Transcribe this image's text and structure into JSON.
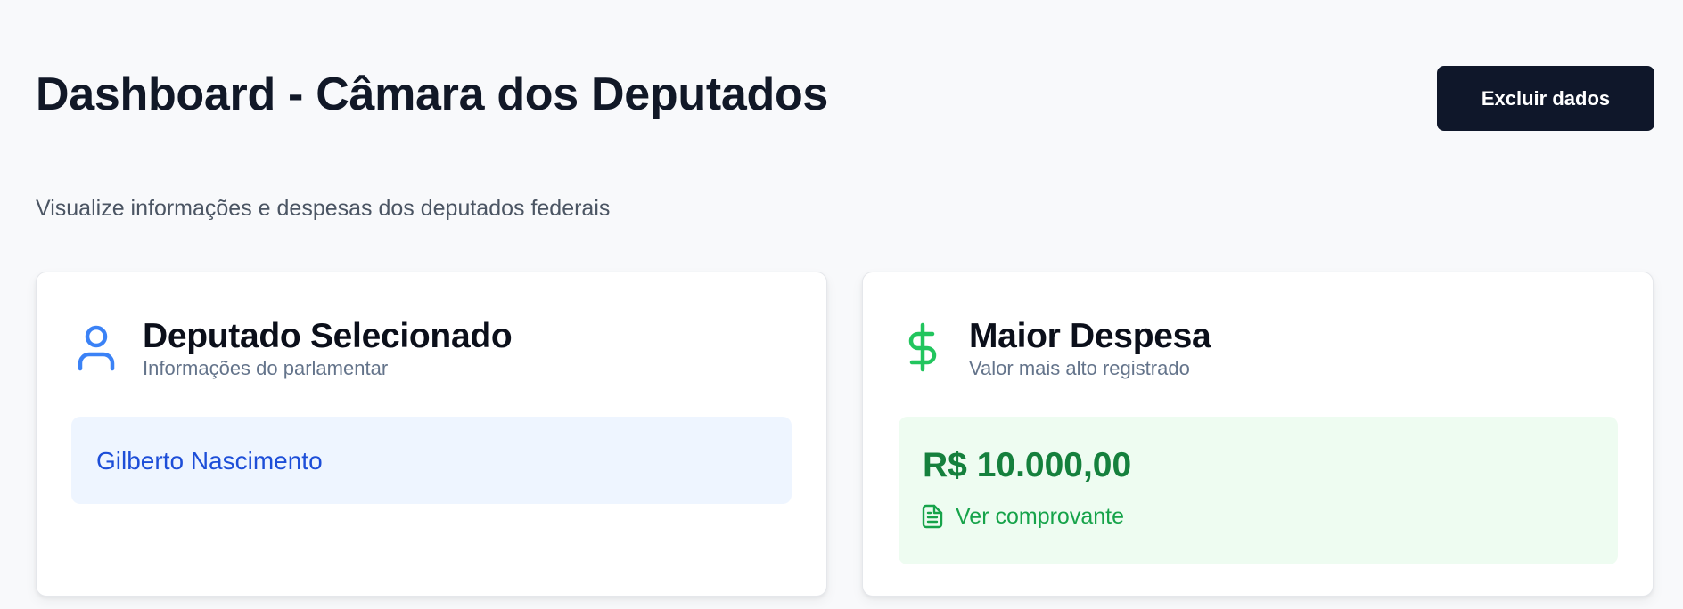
{
  "header": {
    "title": "Dashboard - Câmara dos Deputados",
    "delete_label": "Excluir dados",
    "subtitle": "Visualize informações e despesas dos deputados federais"
  },
  "deputy_card": {
    "icon": "user-icon",
    "title": "Deputado Selecionado",
    "subtitle": "Informações do parlamentar",
    "name": "Gilberto Nascimento"
  },
  "expense_card": {
    "icon": "dollar-icon",
    "title": "Maior Despesa",
    "subtitle": "Valor mais alto registrado",
    "value": "R$ 10.000,00",
    "receipt_icon": "file-text-icon",
    "receipt_label": "Ver comprovante"
  },
  "colors": {
    "user_icon": "#3b82f6",
    "dollar_icon": "#22c55e",
    "button_bg": "#0f172a"
  }
}
